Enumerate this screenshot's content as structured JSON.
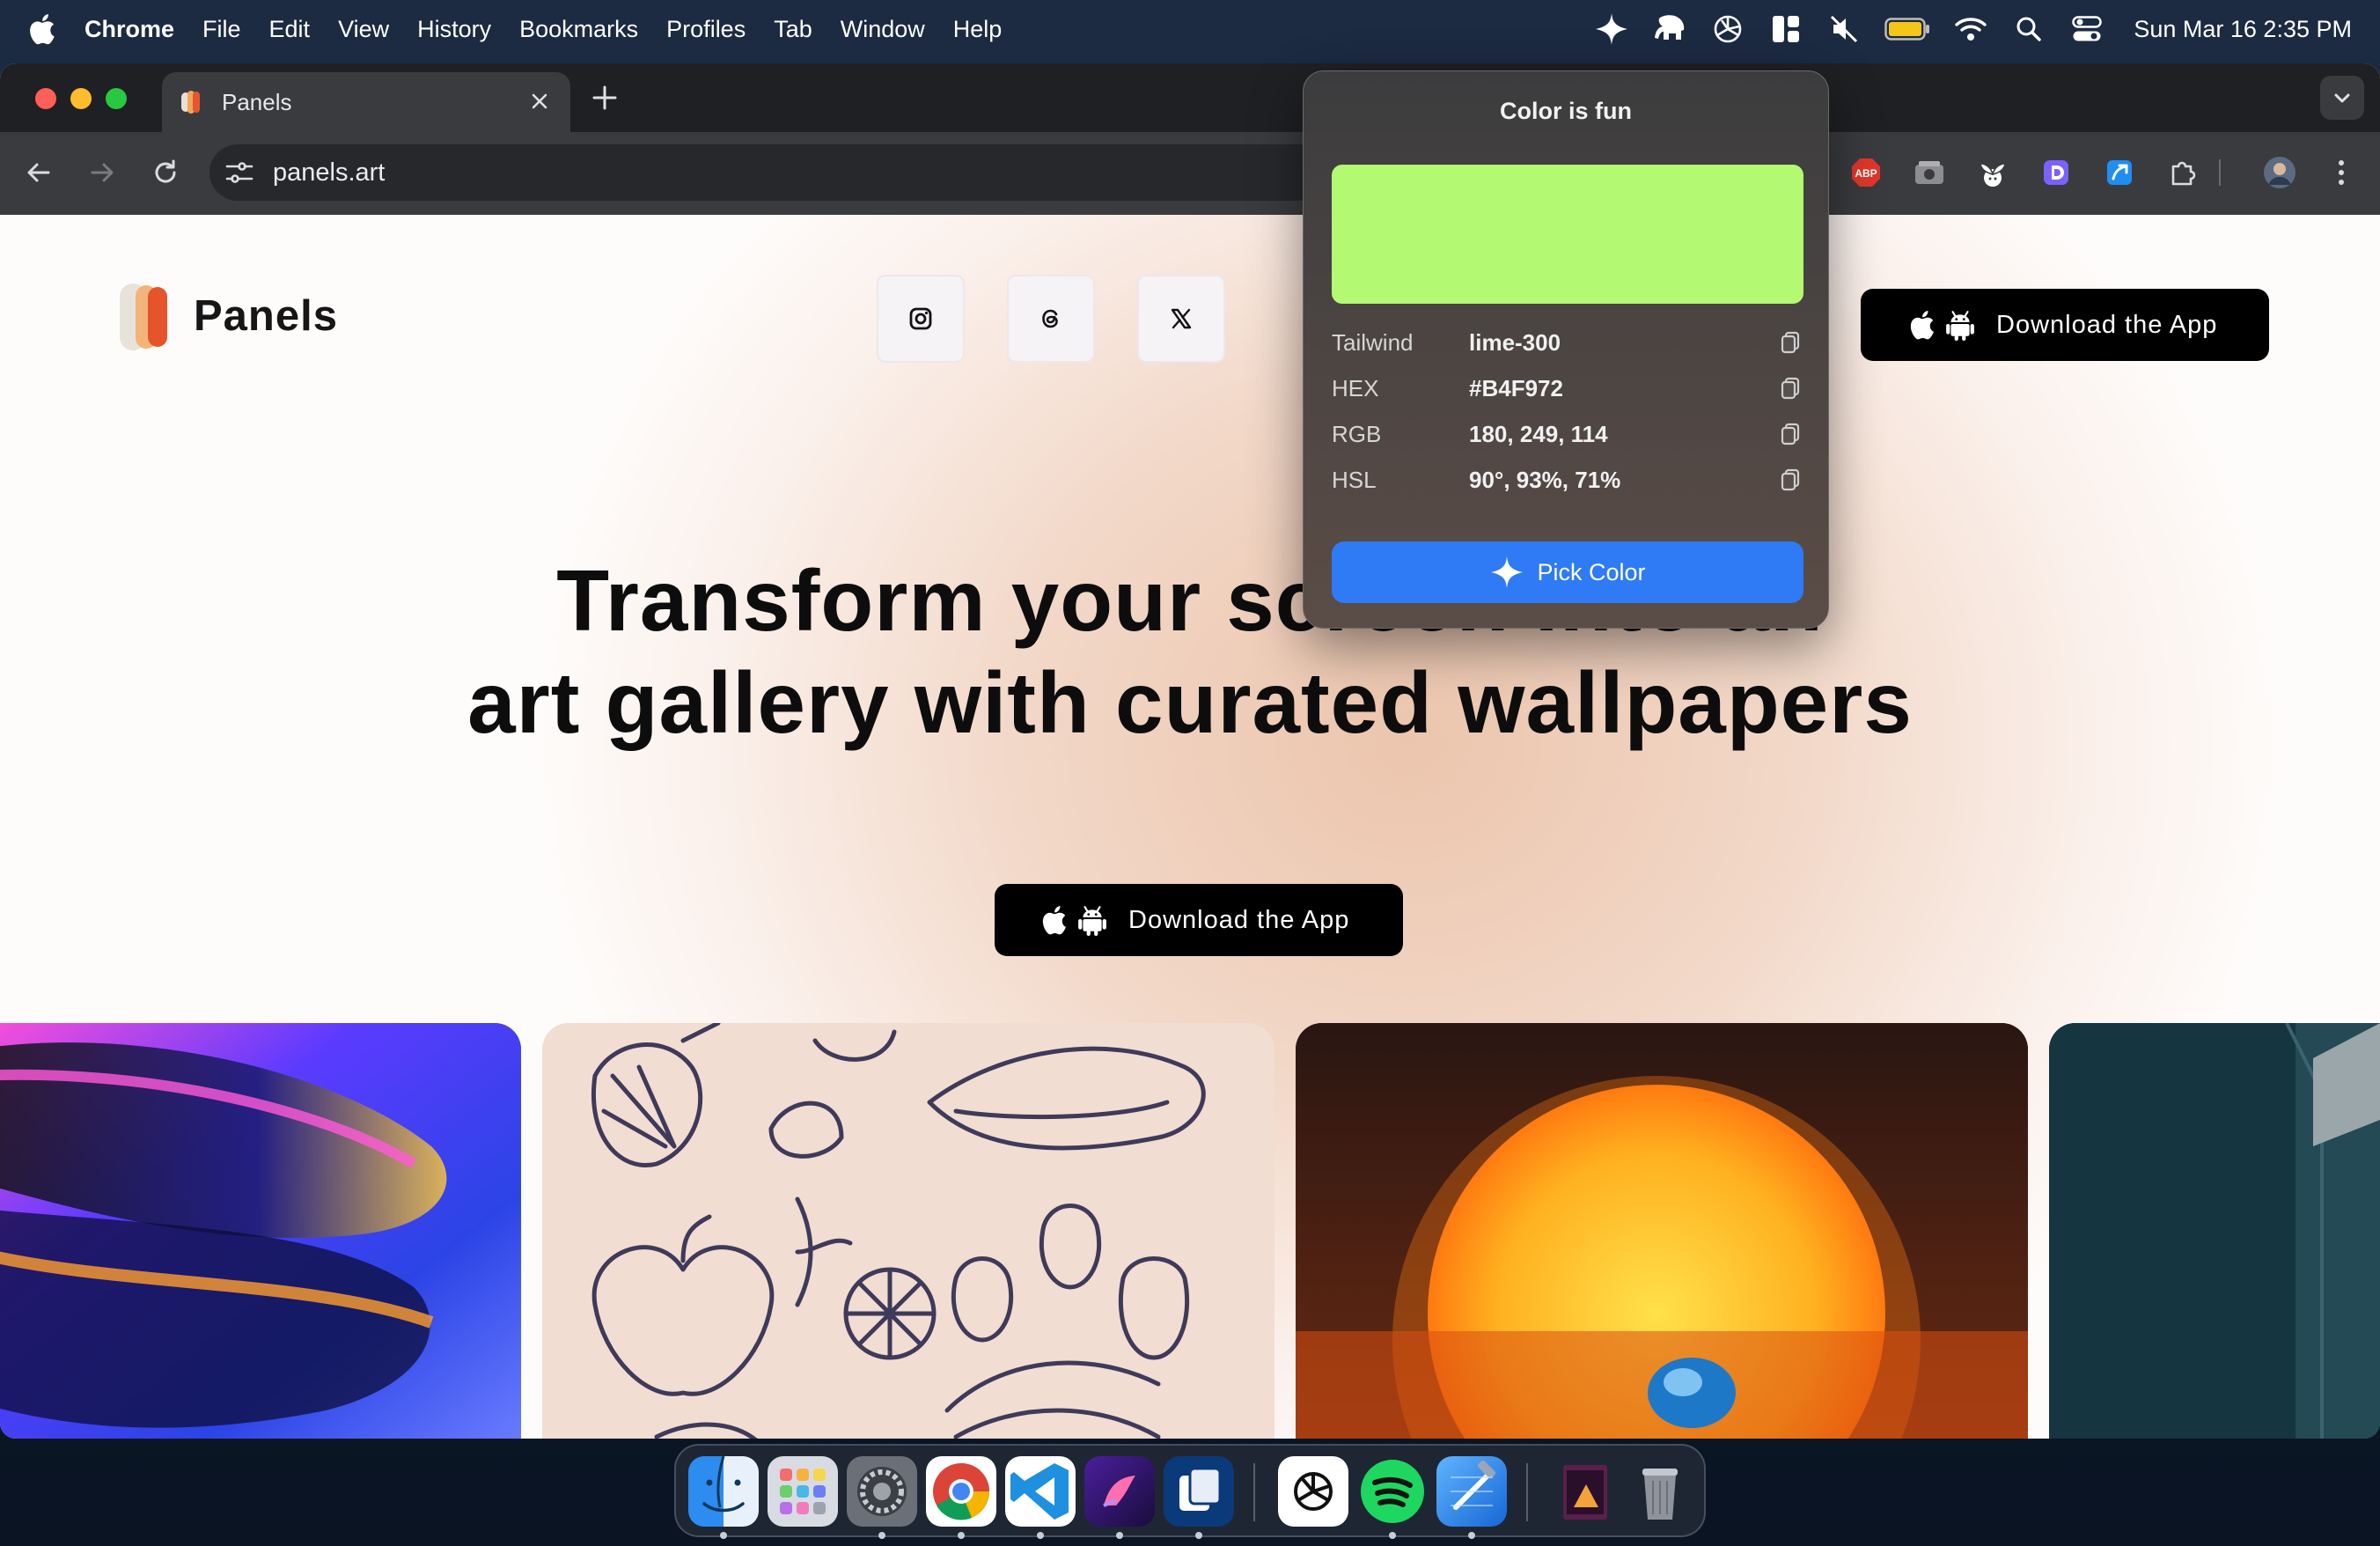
{
  "menubar": {
    "app_name": "Chrome",
    "menus": [
      "File",
      "Edit",
      "View",
      "History",
      "Bookmarks",
      "Profiles",
      "Tab",
      "Window",
      "Help"
    ],
    "clock": "Sun Mar 16  2:35 PM",
    "status_icons": [
      "color-picker-icon",
      "elephant-icon",
      "openai-icon",
      "layout-icon",
      "mute-icon",
      "battery-icon",
      "wifi-icon",
      "search-icon",
      "control-center-icon"
    ]
  },
  "browser": {
    "tab_title": "Panels",
    "url": "panels.art",
    "extensions": [
      "adblock-plus-icon",
      "screenshot-icon",
      "sprout-icon",
      "d-extension-icon",
      "arrow-extension-icon",
      "puzzle-icon",
      "profile-avatar-icon"
    ]
  },
  "page": {
    "brand": "Panels",
    "social": [
      "instagram-icon",
      "threads-icon",
      "x-icon"
    ],
    "download_label": "Download the App",
    "hero_line1": "Transform your screen into an",
    "hero_line2": "art gallery with curated wallpapers",
    "hero_cta": "Download the App"
  },
  "color_popover": {
    "title": "Color is fun",
    "swatch_color": "#B4F972",
    "rows": [
      {
        "label": "Tailwind",
        "value": "lime-300"
      },
      {
        "label": "HEX",
        "value": "#B4F972"
      },
      {
        "label": "RGB",
        "value": "180, 249, 114"
      },
      {
        "label": "HSL",
        "value": "90°, 93%, 71%"
      }
    ],
    "pick_label": "Pick Color",
    "accent": "#2F7AF5"
  },
  "dock": {
    "apps": [
      "Finder",
      "Launchpad",
      "System Settings",
      "Chrome",
      "VS Code",
      "Pockity",
      "Panels",
      "ChatGPT",
      "Spotify",
      "Xcode",
      "Preview",
      "Trash"
    ]
  }
}
